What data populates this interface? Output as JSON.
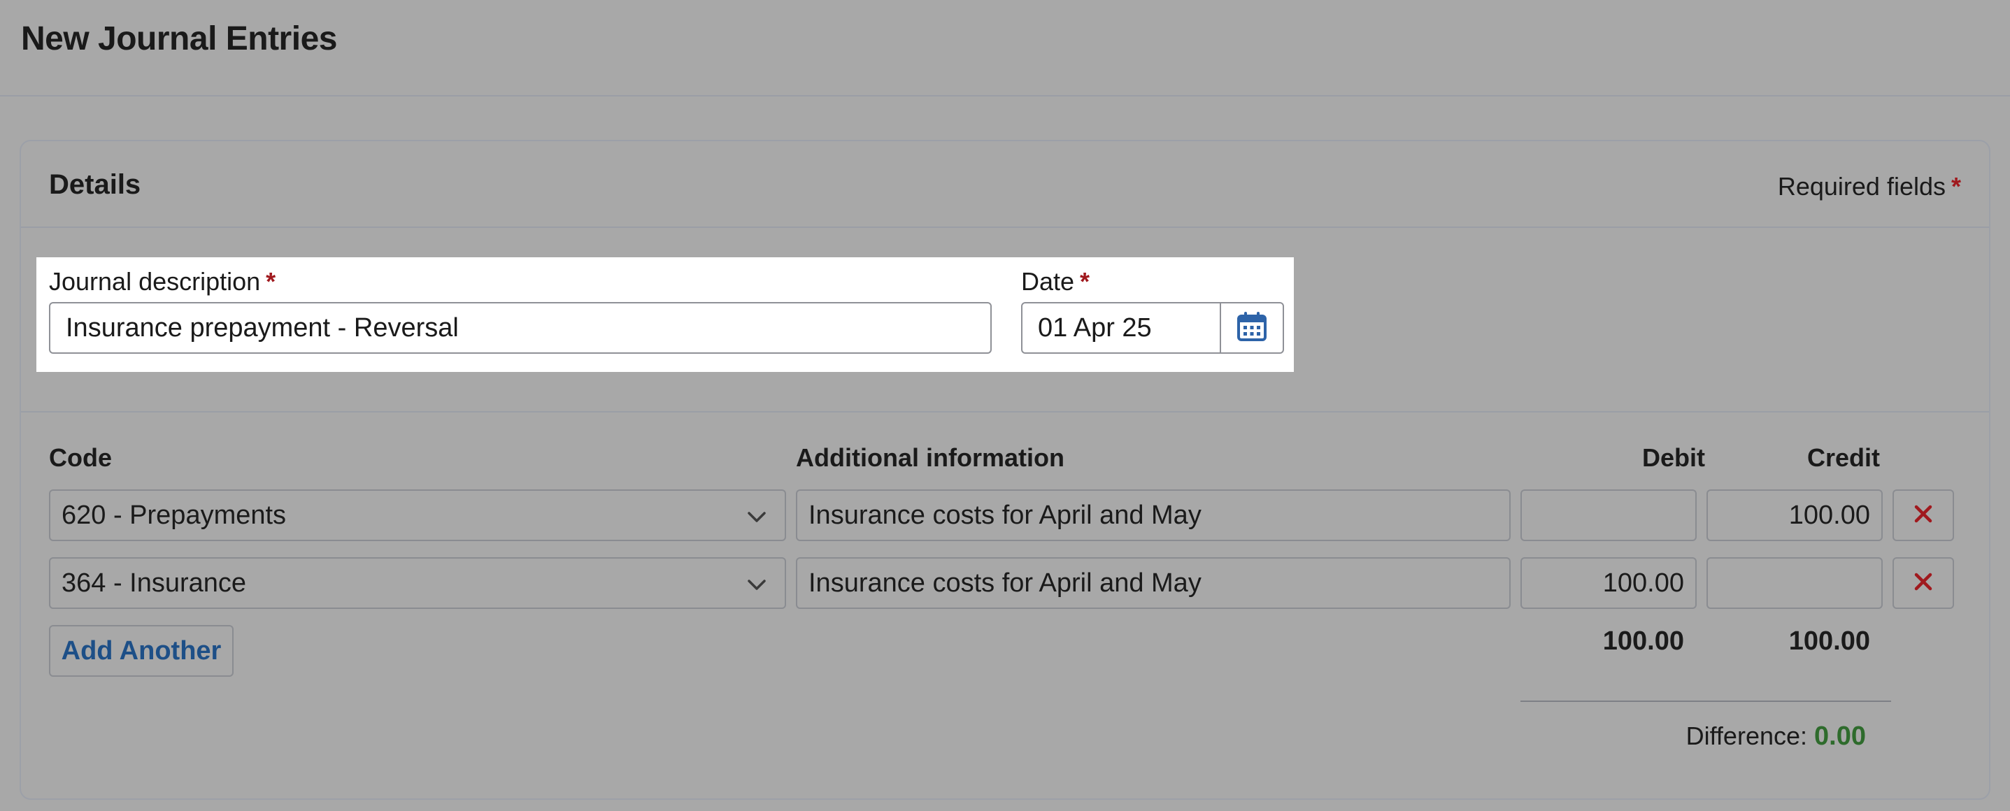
{
  "page": {
    "title": "New Journal Entries"
  },
  "details": {
    "title": "Details",
    "required_note": "Required fields",
    "required_mark": "*"
  },
  "form": {
    "description_label": "Journal description",
    "description_value": "Insurance prepayment - Reversal",
    "date_label": "Date",
    "date_value": "01 Apr 25"
  },
  "table": {
    "headers": {
      "code": "Code",
      "info": "Additional information",
      "debit": "Debit",
      "credit": "Credit"
    },
    "rows": [
      {
        "code": "620 - Prepayments",
        "info": "Insurance costs for April and May",
        "debit": "",
        "credit": "100.00"
      },
      {
        "code": "364 - Insurance",
        "info": "Insurance costs for April and May",
        "debit": "100.00",
        "credit": ""
      }
    ],
    "add_label": "Add Another",
    "total_debit": "100.00",
    "total_credit": "100.00",
    "difference_label": "Difference:",
    "difference_value": "0.00"
  },
  "icons": {
    "calendar": "calendar-icon",
    "chevron": "chevron-down-icon",
    "delete": "close-icon"
  },
  "colors": {
    "required": "#a0191e",
    "link": "#1d4f87",
    "difference": "#2e6b2c",
    "calendar": "#2d63a8"
  }
}
